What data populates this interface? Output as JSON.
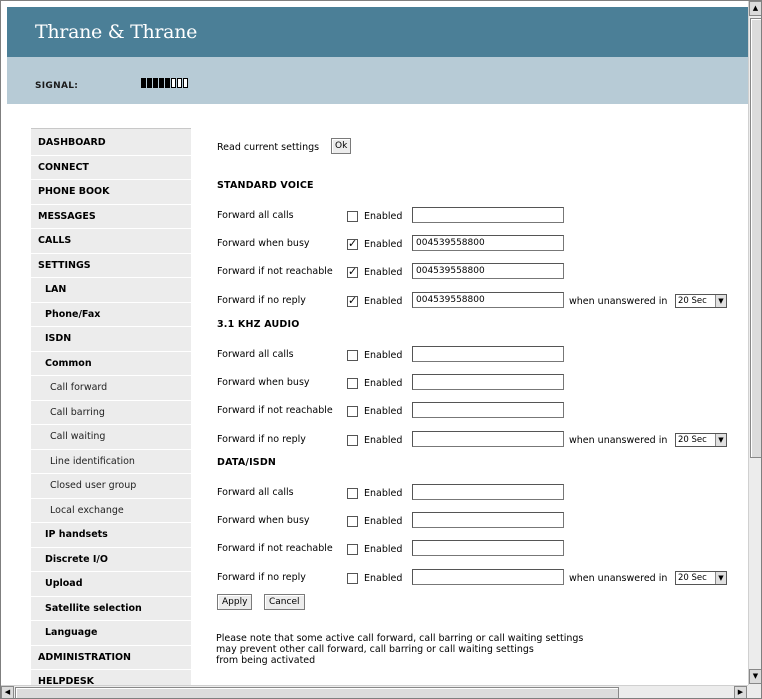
{
  "header": {
    "brand": "Thrane & Thrane"
  },
  "signal": {
    "label": "SIGNAL:",
    "bars_total": 8,
    "bars_active": 5
  },
  "sidebar": {
    "items": [
      {
        "label": "DASHBOARD",
        "level": 0,
        "key": "dashboard"
      },
      {
        "label": "CONNECT",
        "level": 0,
        "key": "connect"
      },
      {
        "label": "PHONE BOOK",
        "level": 0,
        "key": "phone-book"
      },
      {
        "label": "MESSAGES",
        "level": 0,
        "key": "messages"
      },
      {
        "label": "CALLS",
        "level": 0,
        "key": "calls"
      },
      {
        "label": "SETTINGS",
        "level": 0,
        "key": "settings"
      },
      {
        "label": "LAN",
        "level": 1,
        "key": "lan"
      },
      {
        "label": "Phone/Fax",
        "level": 1,
        "key": "phone-fax"
      },
      {
        "label": "ISDN",
        "level": 1,
        "key": "isdn"
      },
      {
        "label": "Common",
        "level": 1,
        "key": "common"
      },
      {
        "label": "Call forward",
        "level": 2,
        "key": "call-forward"
      },
      {
        "label": "Call barring",
        "level": 2,
        "key": "call-barring"
      },
      {
        "label": "Call waiting",
        "level": 2,
        "key": "call-waiting"
      },
      {
        "label": "Line identification",
        "level": 2,
        "key": "line-identification"
      },
      {
        "label": "Closed user group",
        "level": 2,
        "key": "closed-user-group"
      },
      {
        "label": "Local exchange",
        "level": 2,
        "key": "local-exchange"
      },
      {
        "label": "IP handsets",
        "level": 1,
        "key": "ip-handsets"
      },
      {
        "label": "Discrete I/O",
        "level": 1,
        "key": "discrete-io"
      },
      {
        "label": "Upload",
        "level": 1,
        "key": "upload"
      },
      {
        "label": "Satellite selection",
        "level": 1,
        "key": "satellite-selection"
      },
      {
        "label": "Language",
        "level": 1,
        "key": "language"
      },
      {
        "label": "ADMINISTRATION",
        "level": 0,
        "key": "administration"
      },
      {
        "label": "HELPDESK",
        "level": 0,
        "key": "helpdesk"
      }
    ]
  },
  "main": {
    "read_label": "Read current settings",
    "ok_label": "Ok",
    "sections": [
      {
        "title": "STANDARD VOICE",
        "key": "standard-voice",
        "rows": [
          {
            "label": "Forward all calls",
            "enabled": false,
            "number": ""
          },
          {
            "label": "Forward when busy",
            "enabled": true,
            "number": "004539558800"
          },
          {
            "label": "Forward if not reachable",
            "enabled": true,
            "number": "004539558800"
          },
          {
            "label": "Forward if no reply",
            "enabled": true,
            "number": "004539558800",
            "unanswered": "20 Sec"
          }
        ]
      },
      {
        "title": "3.1 KHZ AUDIO",
        "key": "audio-3-1-khz",
        "rows": [
          {
            "label": "Forward all calls",
            "enabled": false,
            "number": ""
          },
          {
            "label": "Forward when busy",
            "enabled": false,
            "number": ""
          },
          {
            "label": "Forward if not reachable",
            "enabled": false,
            "number": ""
          },
          {
            "label": "Forward if no reply",
            "enabled": false,
            "number": "",
            "unanswered": "20 Sec"
          }
        ]
      },
      {
        "title": "DATA/ISDN",
        "key": "data-isdn",
        "rows": [
          {
            "label": "Forward all calls",
            "enabled": false,
            "number": ""
          },
          {
            "label": "Forward when busy",
            "enabled": false,
            "number": ""
          },
          {
            "label": "Forward if not reachable",
            "enabled": false,
            "number": ""
          },
          {
            "label": "Forward if no reply",
            "enabled": false,
            "number": "",
            "unanswered": "20 Sec"
          }
        ]
      }
    ],
    "enabled_label": "Enabled",
    "unanswered_label": "when unanswered in",
    "apply_label": "Apply",
    "cancel_label": "Cancel",
    "note_lines": [
      "Please note that some active call forward, call barring or call waiting settings",
      "may prevent other call forward, call barring or call waiting settings",
      "from being activated"
    ]
  },
  "colors": {
    "header_bg": "#4b7f97",
    "signal_bg": "#b7cbd6",
    "nav_bg": "#ececec"
  }
}
